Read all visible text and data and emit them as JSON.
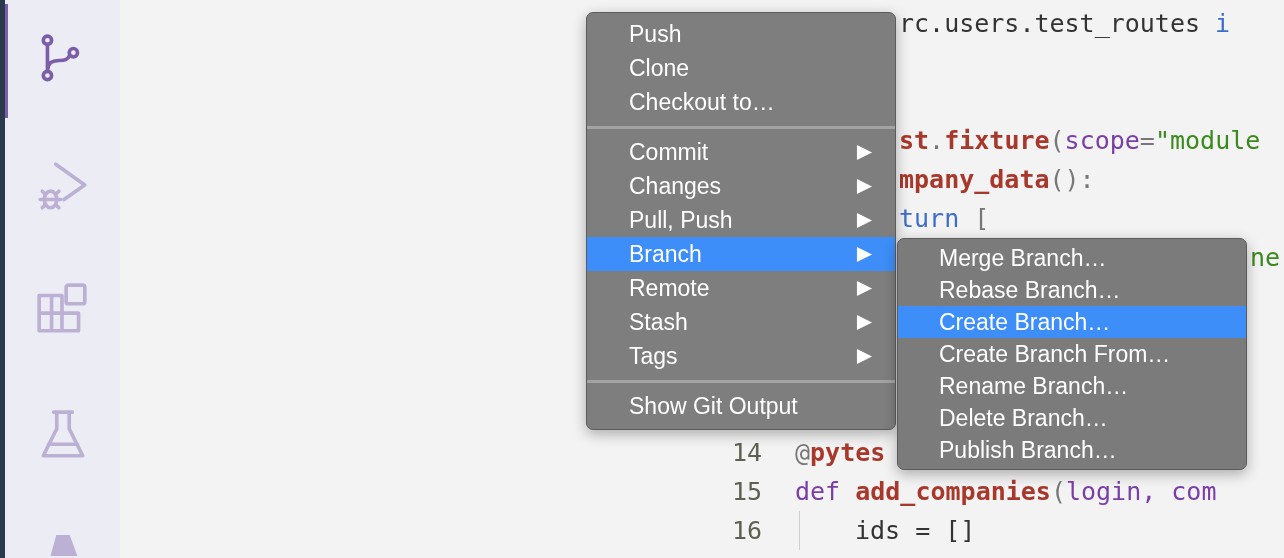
{
  "activity_bar": {
    "items": [
      {
        "selected": true
      },
      {
        "selected": false
      },
      {
        "selected": false
      },
      {
        "selected": false
      },
      {
        "selected": false
      }
    ]
  },
  "editor": {
    "lines": [
      {
        "kind": "after_menu",
        "tokens": [
          {
            "text": "rc.users.test_routes ",
            "kind": "plain"
          },
          {
            "text": "i",
            "kind": "keyword"
          }
        ]
      },
      {
        "kind": "blank"
      },
      {
        "kind": "blank"
      },
      {
        "kind": "after_menu",
        "tokens": [
          {
            "text": "st",
            "kind": "name"
          },
          {
            "text": ".",
            "kind": "punct"
          },
          {
            "text": "fixture",
            "kind": "name"
          },
          {
            "text": "(",
            "kind": "punct"
          },
          {
            "text": "scope",
            "kind": "param"
          },
          {
            "text": "=",
            "kind": "punct"
          },
          {
            "text": "\"module",
            "kind": "string"
          }
        ]
      },
      {
        "kind": "after_menu",
        "tokens": [
          {
            "text": "mpany_data",
            "kind": "name"
          },
          {
            "text": "():",
            "kind": "punct"
          }
        ]
      },
      {
        "kind": "after_menu",
        "tokens": [
          {
            "text": "turn",
            "kind": "keyword"
          },
          {
            "text": " [",
            "kind": "punct"
          }
        ]
      },
      {
        "kind": "after_submenu",
        "tokens": [
          {
            "text": "ne",
            "kind": "string"
          }
        ]
      },
      {
        "kind": "blank"
      },
      {
        "kind": "blank"
      },
      {
        "kind": "blank"
      },
      {
        "kind": "blank"
      },
      {
        "kind": "full",
        "number": "14",
        "tokens": [
          {
            "text": "@",
            "kind": "punct"
          },
          {
            "text": "pytes",
            "kind": "name"
          }
        ]
      },
      {
        "kind": "full",
        "number": "15",
        "tokens": [
          {
            "text": "def ",
            "kind": "def"
          },
          {
            "text": "add_companies",
            "kind": "name"
          },
          {
            "text": "(",
            "kind": "punct"
          },
          {
            "text": "login, com",
            "kind": "param"
          }
        ]
      },
      {
        "kind": "indented",
        "number": "16",
        "tokens": [
          {
            "text": "ids = []",
            "kind": "plain"
          }
        ]
      }
    ]
  },
  "context_menu": {
    "items": [
      {
        "kind": "item",
        "label": "Push",
        "has_submenu": false,
        "selected": false
      },
      {
        "kind": "item",
        "label": "Clone",
        "has_submenu": false,
        "selected": false
      },
      {
        "kind": "item",
        "label": "Checkout to…",
        "has_submenu": false,
        "selected": false
      },
      {
        "kind": "separator"
      },
      {
        "kind": "item",
        "label": "Commit",
        "has_submenu": true,
        "selected": false
      },
      {
        "kind": "item",
        "label": "Changes",
        "has_submenu": true,
        "selected": false
      },
      {
        "kind": "item",
        "label": "Pull, Push",
        "has_submenu": true,
        "selected": false
      },
      {
        "kind": "item",
        "label": "Branch",
        "has_submenu": true,
        "selected": true
      },
      {
        "kind": "item",
        "label": "Remote",
        "has_submenu": true,
        "selected": false
      },
      {
        "kind": "item",
        "label": "Stash",
        "has_submenu": true,
        "selected": false
      },
      {
        "kind": "item",
        "label": "Tags",
        "has_submenu": true,
        "selected": false
      },
      {
        "kind": "separator"
      },
      {
        "kind": "item",
        "label": "Show Git Output",
        "has_submenu": false,
        "selected": false
      }
    ]
  },
  "submenu": {
    "items": [
      {
        "label": "Merge Branch…",
        "selected": false
      },
      {
        "label": "Rebase Branch…",
        "selected": false
      },
      {
        "label": "Create Branch…",
        "selected": true
      },
      {
        "label": "Create Branch From…",
        "selected": false
      },
      {
        "label": "Rename Branch…",
        "selected": false
      },
      {
        "label": "Delete Branch…",
        "selected": false
      },
      {
        "label": "Publish Branch…",
        "selected": false
      }
    ]
  }
}
